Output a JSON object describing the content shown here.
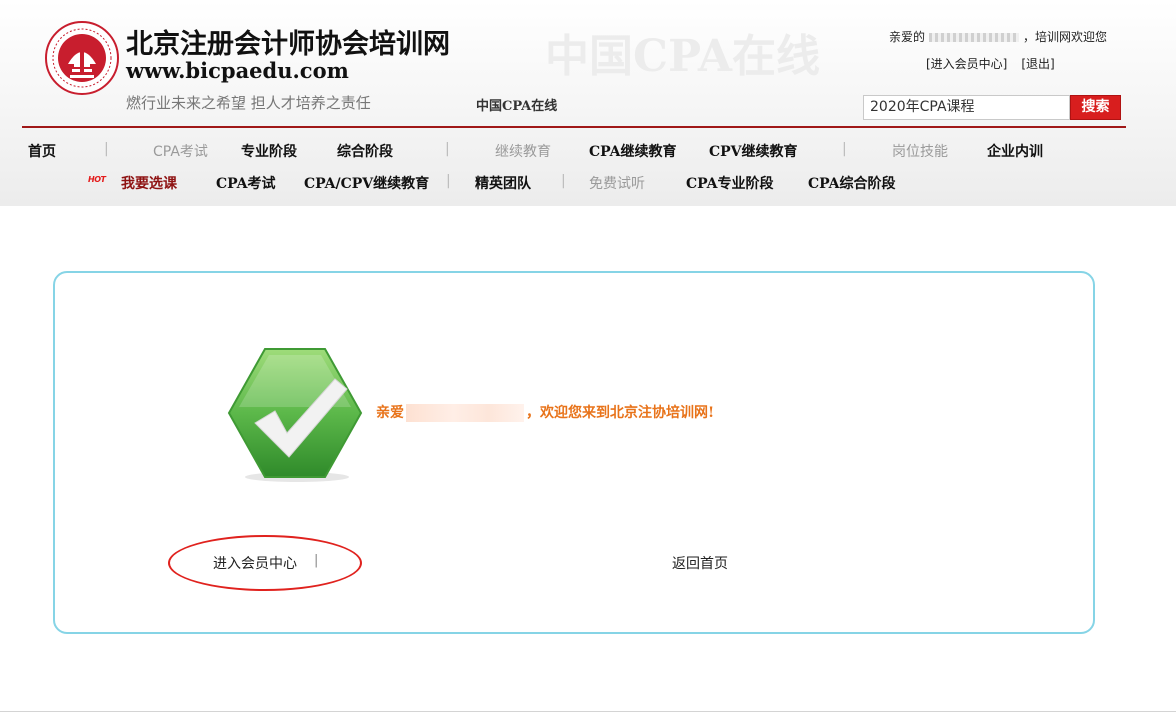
{
  "header": {
    "site_title": "北京注册会计师协会培训网",
    "site_url": "www.bicpaedu.com",
    "slogan": "燃行业未来之希望  担人才培养之责任",
    "watermark": "中国CPA在线",
    "cpa_online": "中国CPA在线",
    "welcome_prefix": "亲爱的",
    "welcome_suffix": "，培训网欢迎您",
    "member_center_link": "[进入会员中心]",
    "logout_link": "[退出]",
    "search_value": "2020年CPA课程",
    "search_button": "搜索"
  },
  "nav_row1": [
    {
      "label": "首页",
      "style": "bold"
    },
    {
      "label": "CPA考试",
      "style": "gray"
    },
    {
      "label": "专业阶段",
      "style": "bold"
    },
    {
      "label": "综合阶段",
      "style": "bold"
    },
    {
      "label": "继续教育",
      "style": "gray"
    },
    {
      "label": "CPA继续教育",
      "style": "bold"
    },
    {
      "label": "CPV继续教育",
      "style": "bold"
    },
    {
      "label": "岗位技能",
      "style": "gray"
    },
    {
      "label": "企业内训",
      "style": "bold"
    }
  ],
  "nav_row2": {
    "hot_badge": "HOT",
    "items": [
      {
        "label": "我要选课",
        "style": "hot"
      },
      {
        "label": "CPA考试",
        "style": "bold"
      },
      {
        "label": "CPA/CPV继续教育",
        "style": "bold"
      },
      {
        "label": "精英团队",
        "style": "bold"
      },
      {
        "label": "免费试听",
        "style": "gray"
      },
      {
        "label": "CPA专业阶段",
        "style": "bold"
      },
      {
        "label": "CPA综合阶段",
        "style": "bold"
      }
    ]
  },
  "separator": "|",
  "content": {
    "welcome_prefix": "亲爱",
    "welcome_suffix": "，欢迎您来到北京注协培训网!",
    "member_center_link": "进入会员中心",
    "home_link": "返回首页"
  },
  "colors": {
    "accent_red": "#a01818",
    "search_button": "#d81e1e",
    "welcome_text": "#e8731a",
    "box_border": "#86d4e6",
    "check_green": "#5cb84a"
  }
}
